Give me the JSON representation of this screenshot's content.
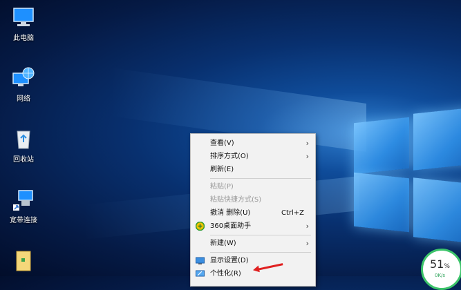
{
  "desktop": {
    "icons": [
      {
        "label": "此电脑",
        "icon": "computer-icon"
      },
      {
        "label": "网络",
        "icon": "network-icon"
      },
      {
        "label": "回收站",
        "icon": "recycle-bin-icon"
      },
      {
        "label": "宽带连接",
        "icon": "broadband-connection-icon"
      },
      {
        "label": "",
        "icon": "folder-icon"
      }
    ]
  },
  "context_menu": {
    "items": [
      {
        "label": "查看(V)",
        "submenu": true
      },
      {
        "label": "排序方式(O)",
        "submenu": true
      },
      {
        "label": "刷新(E)"
      },
      {
        "label": "粘贴(P)",
        "disabled": true
      },
      {
        "label": "粘贴快捷方式(S)",
        "disabled": true
      },
      {
        "label": "撤消 删除(U)",
        "shortcut": "Ctrl+Z"
      },
      {
        "label": "360桌面助手",
        "submenu": true,
        "icon": "360-assistant-icon"
      },
      {
        "label": "新建(W)",
        "submenu": true
      },
      {
        "label": "显示设置(D)",
        "icon": "display-settings-icon"
      },
      {
        "label": "个性化(R)",
        "icon": "personalize-icon"
      }
    ],
    "submenu_glyph": "›"
  },
  "widget": {
    "percent": "51",
    "percent_unit": "%",
    "speed": "0K/s",
    "accent": "#3cc46a"
  },
  "colors": {
    "menu_bg": "#f2f2f2",
    "annotation_arrow": "#e02020"
  }
}
